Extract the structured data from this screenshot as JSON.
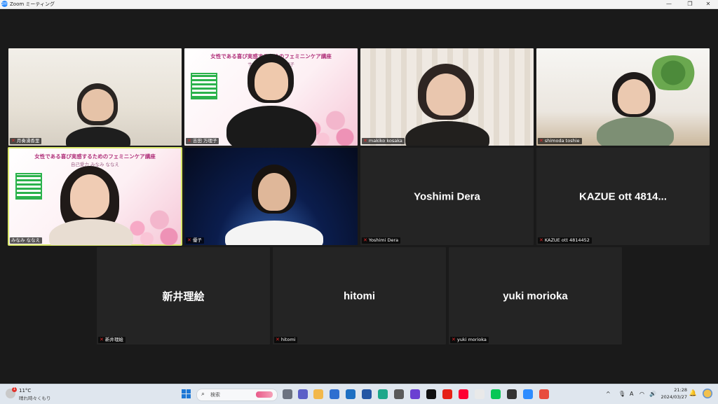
{
  "window": {
    "title": "Zoom ミーティング",
    "logo_text": "zm",
    "minimize_glyph": "—",
    "maximize_glyph": "❐",
    "close_glyph": "✕"
  },
  "tiles": {
    "video1": {
      "name": "月奏湧香里",
      "has_video": true
    },
    "video2": {
      "name": "吉田 万理子",
      "has_video": true,
      "slide_title": "女性である喜び実感するためのフェミニンケア講座",
      "slide_sub": "サロンプル 吉田万理子"
    },
    "video3": {
      "name": "makiko kosaka",
      "has_video": true
    },
    "video4": {
      "name": "shimoda toshie",
      "has_video": true
    },
    "video5": {
      "name": "みなみ ななえ",
      "has_video": true,
      "active_speaker": true,
      "slide_title": "女性である喜び実感するためのフェミニンケア講座",
      "slide_sub": "自己愛力 みなみ ななえ"
    },
    "video6": {
      "name": "優子",
      "has_video": true
    },
    "name7": {
      "display": "Yoshimi Dera",
      "label": "Yoshimi Dera"
    },
    "name8": {
      "display": "KAZUE ott 4814...",
      "label": "KAZUE ott 4814452"
    },
    "name9": {
      "display": "新井理絵",
      "label": "新井理絵"
    },
    "name10": {
      "display": "hitomi",
      "label": "hitomi"
    },
    "name11": {
      "display": "yuki morioka",
      "label": "yuki morioka"
    }
  },
  "muted_icon": "mic-muted-icon",
  "taskbar": {
    "weather": {
      "temp": "11°C",
      "desc": "晴れ時々くもり",
      "badge": "1"
    },
    "search_placeholder": "検索",
    "tray": {
      "chevron": "^",
      "ime": "A",
      "wifi": "◠",
      "volume": "🔊"
    },
    "clock": {
      "time": "21:28",
      "date": "2024/03/27"
    }
  },
  "colors": {
    "stage_bg": "#1a1a1a",
    "tile_bg": "#242424",
    "active_speaker_border": "#d9e86b",
    "muted_red": "#e02828",
    "taskbar_bg": "#dfe6ee",
    "zoom_blue": "#2d8cff"
  }
}
